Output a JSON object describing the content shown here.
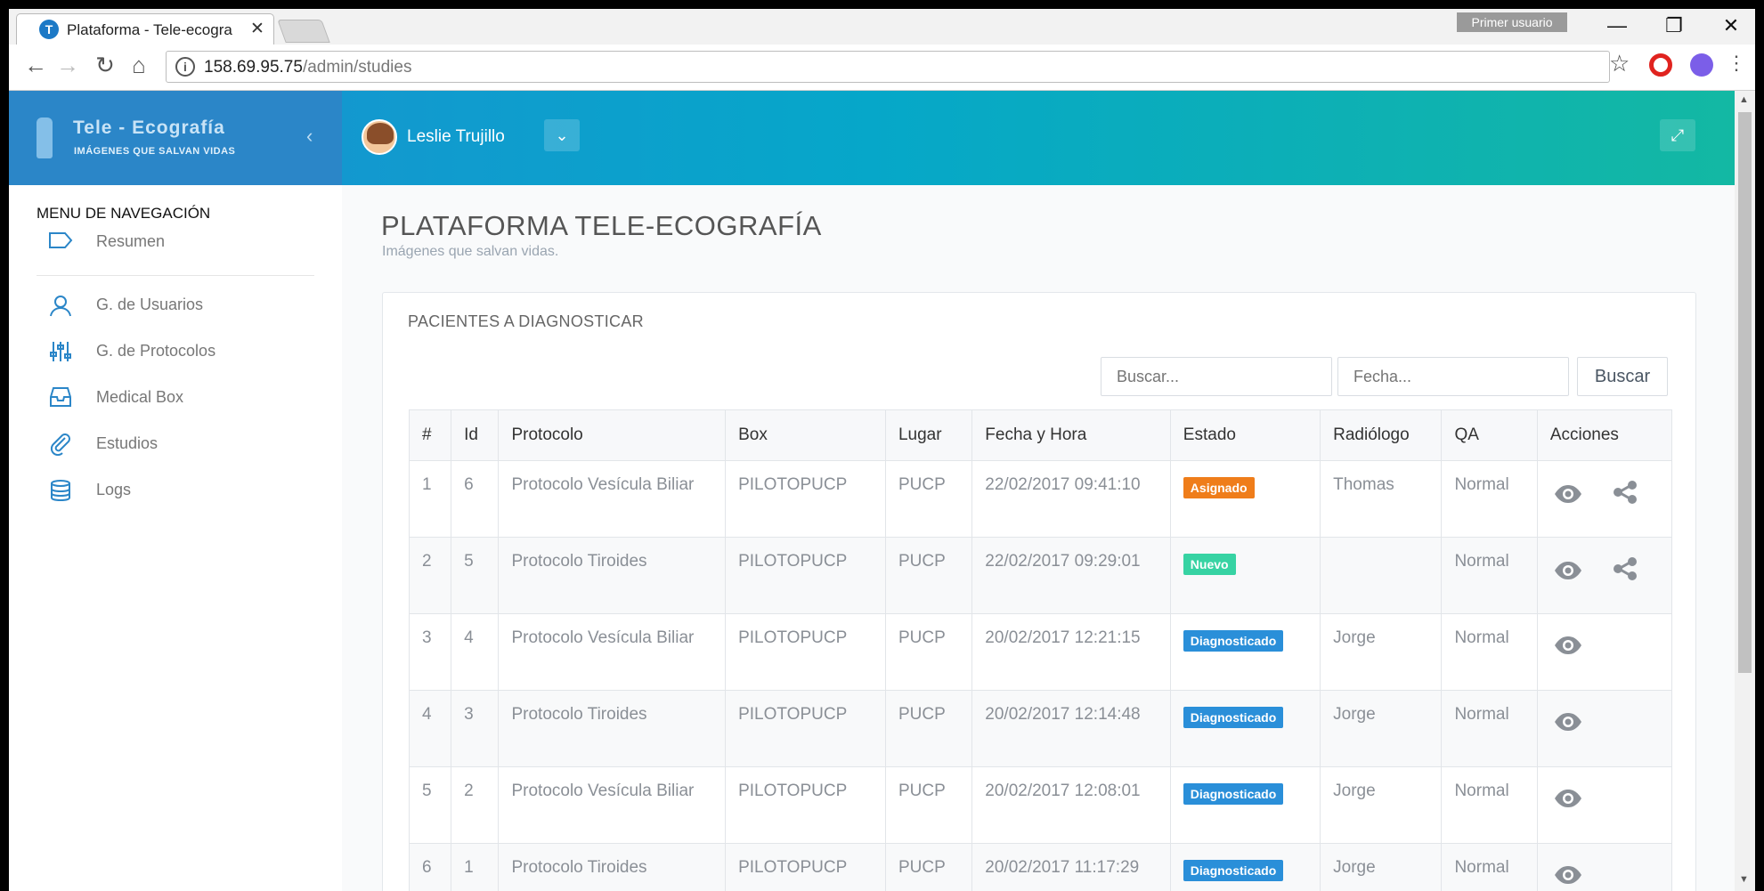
{
  "browser": {
    "tab_title": "Plataforma - Tele-ecogra",
    "tab_close": "✕",
    "favicon": "T",
    "user_badge": "Primer usuario",
    "url_host": "158.69.95.75",
    "url_path": "/admin/studies"
  },
  "brand": {
    "title": "Tele - Ecografía",
    "tagline": "IMÁGENES QUE SALVAN VIDAS"
  },
  "header": {
    "user_name": "Leslie Trujillo"
  },
  "sidebar": {
    "heading": "MENU DE NAVEGACIÓN",
    "items": [
      {
        "label": "Resumen",
        "icon": "tag-icon"
      },
      {
        "label": "G. de Usuarios",
        "icon": "user-icon"
      },
      {
        "label": "G. de Protocolos",
        "icon": "sliders-icon"
      },
      {
        "label": "Medical Box",
        "icon": "inbox-icon"
      },
      {
        "label": "Estudios",
        "icon": "paperclip-icon"
      },
      {
        "label": "Logs",
        "icon": "database-icon"
      }
    ]
  },
  "main": {
    "title": "PLATAFORMA TELE-ECOGRAFÍA",
    "subtitle": "Imágenes que salvan vidas.",
    "card_title": "PACIENTES A DIAGNOSTICAR",
    "search_placeholder": "Buscar...",
    "date_placeholder": "Fecha...",
    "search_button": "Buscar",
    "columns": [
      "#",
      "Id",
      "Protocolo",
      "Box",
      "Lugar",
      "Fecha y Hora",
      "Estado",
      "Radiólogo",
      "QA",
      "Acciones"
    ],
    "rows": [
      {
        "n": "1",
        "id": "6",
        "protocolo": "Protocolo Vesícula Biliar",
        "box": "PILOTOPUCP",
        "lugar": "PUCP",
        "fecha": "22/02/2017 09:41:10",
        "estado": "Asignado",
        "estado_color": "#ef7d1a",
        "radiologo": "Thomas",
        "qa": "Normal",
        "share": true
      },
      {
        "n": "2",
        "id": "5",
        "protocolo": "Protocolo Tiroides",
        "box": "PILOTOPUCP",
        "lugar": "PUCP",
        "fecha": "22/02/2017 09:29:01",
        "estado": "Nuevo",
        "estado_color": "#37d3a3",
        "radiologo": "",
        "qa": "Normal",
        "share": true
      },
      {
        "n": "3",
        "id": "4",
        "protocolo": "Protocolo Vesícula Biliar",
        "box": "PILOTOPUCP",
        "lugar": "PUCP",
        "fecha": "20/02/2017 12:21:15",
        "estado": "Diagnosticado",
        "estado_color": "#2a8fd9",
        "radiologo": "Jorge",
        "qa": "Normal",
        "share": false
      },
      {
        "n": "4",
        "id": "3",
        "protocolo": "Protocolo Tiroides",
        "box": "PILOTOPUCP",
        "lugar": "PUCP",
        "fecha": "20/02/2017 12:14:48",
        "estado": "Diagnosticado",
        "estado_color": "#2a8fd9",
        "radiologo": "Jorge",
        "qa": "Normal",
        "share": false
      },
      {
        "n": "5",
        "id": "2",
        "protocolo": "Protocolo Vesícula Biliar",
        "box": "PILOTOPUCP",
        "lugar": "PUCP",
        "fecha": "20/02/2017 12:08:01",
        "estado": "Diagnosticado",
        "estado_color": "#2a8fd9",
        "radiologo": "Jorge",
        "qa": "Normal",
        "share": false
      },
      {
        "n": "6",
        "id": "1",
        "protocolo": "Protocolo Tiroides",
        "box": "PILOTOPUCP",
        "lugar": "PUCP",
        "fecha": "20/02/2017 11:17:29",
        "estado": "Diagnosticado",
        "estado_color": "#2a8fd9",
        "radiologo": "Jorge",
        "qa": "Normal",
        "share": false
      }
    ]
  }
}
